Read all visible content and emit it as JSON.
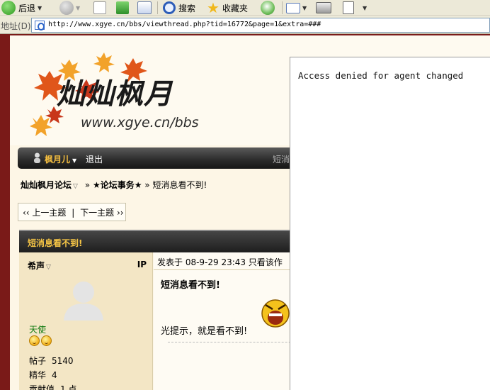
{
  "toolbar": {
    "back_label": "后退",
    "search_label": "搜索",
    "favorites_label": "收藏夹"
  },
  "address": {
    "label": "地址(D)",
    "url": "http://www.xgye.cn/bbs/viewthread.php?tid=16772&page=1&extra=###"
  },
  "header": {
    "logo_title": "灿灿枫月",
    "logo_url": "www.xgye.cn/bbs"
  },
  "userbar": {
    "username": "枫月儿",
    "logout_label": "退出",
    "pm_label": "短消"
  },
  "breadcrumb": {
    "forum_name": "灿灿枫月论坛",
    "section_name": "★论坛事务★",
    "thread_title": "短消息看不到!"
  },
  "threadnav": {
    "prev_label": "‹‹ 上一主题",
    "separator": "|",
    "next_label": "下一主题 ››"
  },
  "post": {
    "header_title": "短消息看不到!",
    "author": {
      "name": "希声",
      "ip_label": "IP",
      "rank": "天使",
      "stats": [
        {
          "label": "帖子",
          "value": "5140"
        },
        {
          "label": "精华",
          "value": "4"
        },
        {
          "label": "贡献值",
          "value": "1 点"
        }
      ]
    },
    "meta_text": "发表于  08-9-29 23:43  只看该作",
    "title": "短消息看不到!",
    "content": "光提示，就是看不到!"
  },
  "agent_panel": {
    "message": "Access denied for agent changed"
  },
  "colors": {
    "page_border": "#7a1a18",
    "username": "#f7c040",
    "rank": "#117a11"
  }
}
